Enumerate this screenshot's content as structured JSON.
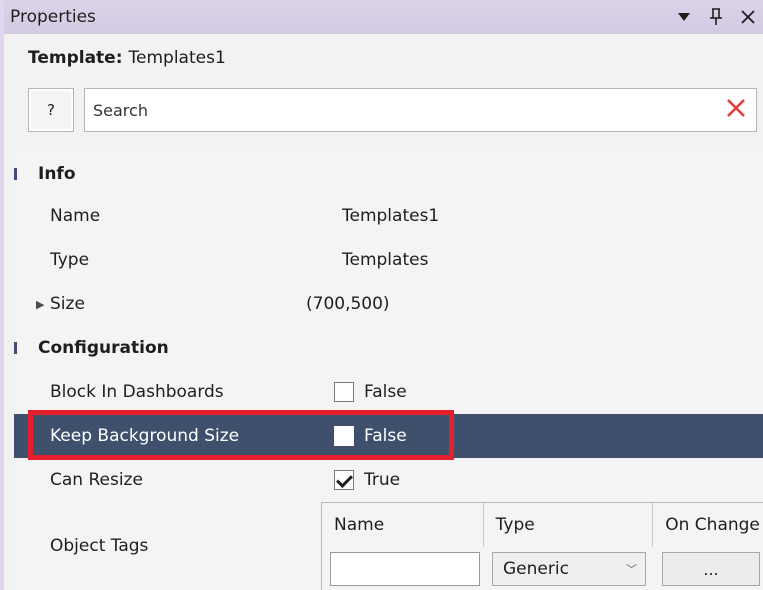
{
  "window": {
    "title": "Properties",
    "dropdown_icon": "triangle-down-icon",
    "pin_icon": "pin-icon",
    "close_icon": "close-icon"
  },
  "template": {
    "key": "Template:",
    "value": "Templates1"
  },
  "search": {
    "help_label": "?",
    "placeholder": "Search",
    "clear_icon": "clear-x-icon"
  },
  "info": {
    "category": "Info",
    "name": {
      "label": "Name",
      "value": "Templates1"
    },
    "type": {
      "label": "Type",
      "value": "Templates"
    },
    "size": {
      "label": "Size",
      "value": "(700,500)"
    }
  },
  "configuration": {
    "category": "Configuration",
    "block_in_dashboards": {
      "label": "Block In Dashboards",
      "value": "False",
      "checked": false
    },
    "keep_background_size": {
      "label": "Keep Background Size",
      "value": "False",
      "checked": false,
      "selected": true
    },
    "can_resize": {
      "label": "Can Resize",
      "value": "True",
      "checked": true
    },
    "object_tags": {
      "label": "Object Tags",
      "columns": [
        "Name",
        "Type",
        "On Change"
      ],
      "row": {
        "name": "",
        "type": "Generic",
        "on_change": "..."
      }
    }
  },
  "colors": {
    "selection": "#3f506d",
    "highlight": "#e5202a",
    "titlebar": "#d8cee6"
  }
}
